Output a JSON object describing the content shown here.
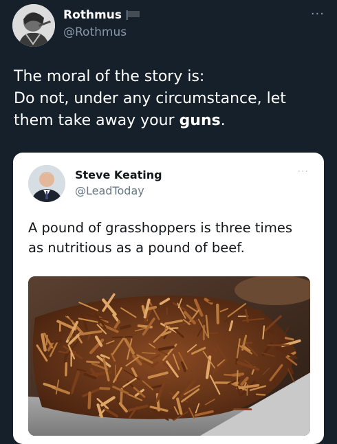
{
  "tweet": {
    "author_name": "Rothmus",
    "author_handle": "@Rothmus",
    "more_label": "···",
    "text_lines": [
      "The moral of the story is:",
      "Do not, under any circumstance, let",
      "them take away your "
    ],
    "text_bold": "guns",
    "text_end": "."
  },
  "quoted_tweet": {
    "author_name": "Steve Keating",
    "author_handle": "@LeadToday",
    "more_label": "···",
    "text_lines": [
      "A pound of grasshoppers is three times",
      "as nutritious as a pound of beef."
    ]
  },
  "colors": {
    "background": "#15202b",
    "card": "#ffffff",
    "secondary_text": "#8b98a5"
  },
  "icons": [
    "flag-icon",
    "more-icon"
  ]
}
